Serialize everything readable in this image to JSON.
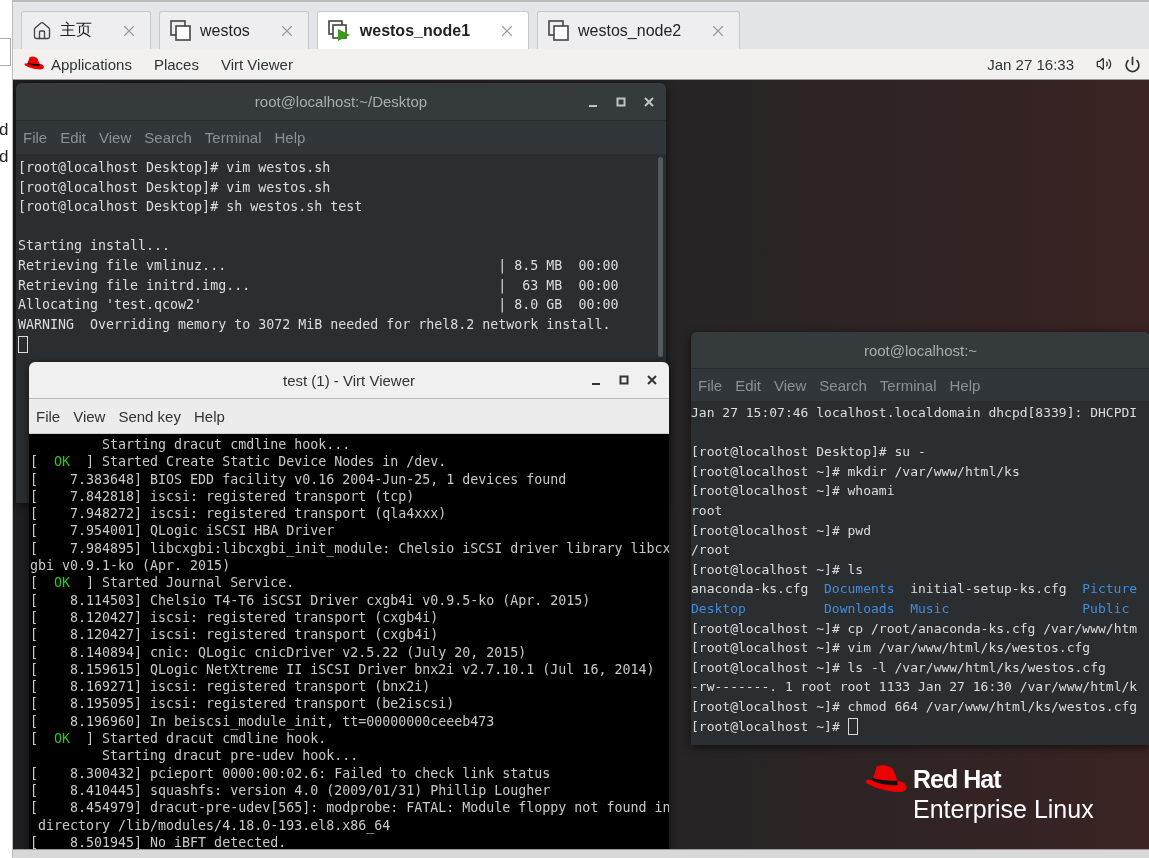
{
  "left_strip": {
    "texts": [
      "d",
      "d"
    ]
  },
  "tabs": [
    {
      "label": "主页",
      "kind": "home",
      "selected": false
    },
    {
      "label": "westos",
      "kind": "vm",
      "selected": false
    },
    {
      "label": "westos_node1",
      "kind": "running",
      "selected": true
    },
    {
      "label": "westos_node2",
      "kind": "vm",
      "selected": false
    }
  ],
  "top_bar": {
    "menus": [
      "Applications",
      "Places",
      "Virt Viewer"
    ],
    "clock": "Jan 27 16:33"
  },
  "windows": [
    {
      "kind": "terminal",
      "title": "root@localhost:~/Desktop",
      "menu": [
        "File",
        "Edit",
        "View",
        "Search",
        "Terminal",
        "Help"
      ],
      "lines": [
        {
          "kind": "text",
          "text": "[root@localhost Desktop]# vim westos.sh"
        },
        {
          "kind": "text",
          "text": "[root@localhost Desktop]# vim westos.sh"
        },
        {
          "kind": "text",
          "text": "[root@localhost Desktop]# sh westos.sh test"
        },
        {
          "kind": "blank"
        },
        {
          "kind": "text",
          "text": "Starting install..."
        },
        {
          "kind": "text",
          "text": "Retrieving file vmlinuz...                                  | 8.5 MB  00:00"
        },
        {
          "kind": "text",
          "text": "Retrieving file initrd.img...                               |  63 MB  00:00"
        },
        {
          "kind": "text",
          "text": "Allocating 'test.qcow2'                                     | 8.0 GB  00:00"
        },
        {
          "kind": "text",
          "text": "WARNING  Overriding memory to 3072 MiB needed for rhel8.2 network install."
        },
        {
          "kind": "cursor"
        }
      ]
    },
    {
      "kind": "terminal",
      "title": "root@localhost:~",
      "menu": [
        "File",
        "Edit",
        "View",
        "Search",
        "Terminal",
        "Help"
      ],
      "lines": [
        {
          "kind": "text",
          "text": "Jan 27 15:07:46 localhost.localdomain dhcpd[8339]: DHCPDI"
        },
        {
          "kind": "blank"
        },
        {
          "kind": "text",
          "text": "[root@localhost Desktop]# su -"
        },
        {
          "kind": "text",
          "text": "[root@localhost ~]# mkdir /var/www/html/ks"
        },
        {
          "kind": "text",
          "text": "[root@localhost ~]# whoami"
        },
        {
          "kind": "text",
          "text": "root"
        },
        {
          "kind": "text",
          "text": "[root@localhost ~]# pwd"
        },
        {
          "kind": "text",
          "text": "/root"
        },
        {
          "kind": "text",
          "text": "[root@localhost ~]# ls"
        },
        {
          "kind": "columns",
          "cells": [
            {
              "text": "anaconda-ks.cfg",
              "kind": "file"
            },
            {
              "text": "Documents",
              "kind": "dir"
            },
            {
              "text": "initial-setup-ks.cfg",
              "kind": "file"
            },
            {
              "text": "Picture",
              "kind": "dir"
            }
          ]
        },
        {
          "kind": "columns",
          "cells": [
            {
              "text": "Desktop",
              "kind": "dir"
            },
            {
              "text": "Downloads",
              "kind": "dir"
            },
            {
              "text": "Music",
              "kind": "dir"
            },
            {
              "text": "Public",
              "kind": "dir"
            }
          ]
        },
        {
          "kind": "text",
          "text": "[root@localhost ~]# cp /root/anaconda-ks.cfg /var/www/htm"
        },
        {
          "kind": "text",
          "text": "[root@localhost ~]# vim /var/www/html/ks/westos.cfg"
        },
        {
          "kind": "text",
          "text": "[root@localhost ~]# ls -l /var/www/html/ks/westos.cfg"
        },
        {
          "kind": "text",
          "text": "-rw-------. 1 root root 1133 Jan 27 16:30 /var/www/html/k"
        },
        {
          "kind": "text",
          "text": "[root@localhost ~]# chmod 664 /var/www/html/ks/westos.cfg"
        },
        {
          "kind": "prompt",
          "text": "[root@localhost ~]# "
        }
      ]
    },
    {
      "kind": "viewer",
      "title": "test (1) - Virt Viewer",
      "menu": [
        "File",
        "View",
        "Send key",
        "Help"
      ],
      "lines": [
        {
          "kind": "text",
          "text": "         Starting dracut cmdline hook..."
        },
        {
          "kind": "mixed",
          "segments": [
            {
              "text": "[  ",
              "kind": "plain"
            },
            {
              "text": "OK",
              "kind": "ok"
            },
            {
              "text": "  ] Started Create Static Device Nodes in /dev.",
              "kind": "plain"
            }
          ]
        },
        {
          "kind": "text",
          "text": "[    7.383648] BIOS EDD facility v0.16 2004-Jun-25, 1 devices found"
        },
        {
          "kind": "text",
          "text": "[    7.842818] iscsi: registered transport (tcp)"
        },
        {
          "kind": "text",
          "text": "[    7.948272] iscsi: registered transport (qla4xxx)"
        },
        {
          "kind": "text",
          "text": "[    7.954001] QLogic iSCSI HBA Driver"
        },
        {
          "kind": "text",
          "text": "[    7.984895] libcxgbi:libcxgbi_init_module: Chelsio iSCSI driver library libcx"
        },
        {
          "kind": "text",
          "text": "gbi v0.9.1-ko (Apr. 2015)"
        },
        {
          "kind": "mixed",
          "segments": [
            {
              "text": "[  ",
              "kind": "plain"
            },
            {
              "text": "OK",
              "kind": "ok"
            },
            {
              "text": "  ] Started Journal Service.",
              "kind": "plain"
            }
          ]
        },
        {
          "kind": "text",
          "text": "[    8.114503] Chelsio T4-T6 iSCSI Driver cxgb4i v0.9.5-ko (Apr. 2015)"
        },
        {
          "kind": "text",
          "text": "[    8.120427] iscsi: registered transport (cxgb4i)"
        },
        {
          "kind": "text",
          "text": "[    8.120427] iscsi: registered transport (cxgb4i)"
        },
        {
          "kind": "text",
          "text": "[    8.140894] cnic: QLogic cnicDriver v2.5.22 (July 20, 2015)"
        },
        {
          "kind": "text",
          "text": "[    8.159615] QLogic NetXtreme II iSCSI Driver bnx2i v2.7.10.1 (Jul 16, 2014)"
        },
        {
          "kind": "text",
          "text": "[    8.169271] iscsi: registered transport (bnx2i)"
        },
        {
          "kind": "text",
          "text": "[    8.195095] iscsi: registered transport (be2iscsi)"
        },
        {
          "kind": "text",
          "text": "[    8.196960] In beiscsi_module_init, tt=00000000ceeeb473"
        },
        {
          "kind": "mixed",
          "segments": [
            {
              "text": "[  ",
              "kind": "plain"
            },
            {
              "text": "OK",
              "kind": "ok"
            },
            {
              "text": "  ] Started dracut cmdline hook.",
              "kind": "plain"
            }
          ]
        },
        {
          "kind": "text",
          "text": "         Starting dracut pre-udev hook..."
        },
        {
          "kind": "text",
          "text": "[    8.300432] pcieport 0000:00:02.6: Failed to check link status"
        },
        {
          "kind": "text",
          "text": "[    8.410445] squashfs: version 4.0 (2009/01/31) Phillip Lougher"
        },
        {
          "kind": "text",
          "text": "[    8.454979] dracut-pre-udev[565]: modprobe: FATAL: Module floppy not found in"
        },
        {
          "kind": "text",
          "text": " directory /lib/modules/4.18.0-193.el8.x86_64"
        },
        {
          "kind": "text",
          "text": "[    8.501945] No iBFT detected."
        }
      ]
    }
  ],
  "desktop_logo": {
    "line_1": "Red Hat",
    "line_2": "Enterprise Linux"
  }
}
